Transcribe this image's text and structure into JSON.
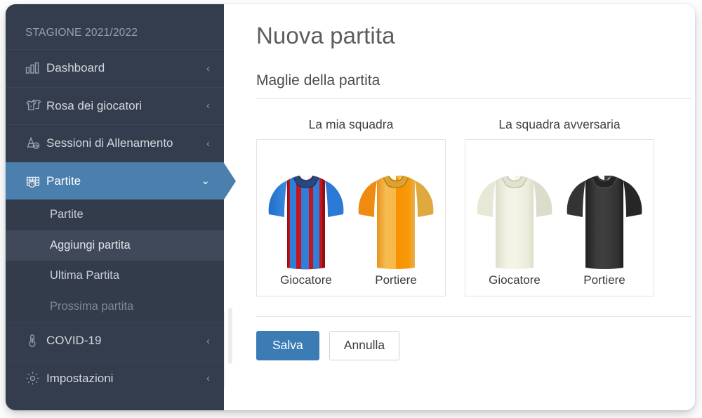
{
  "sidebar": {
    "season": "STAGIONE 2021/2022",
    "items": [
      {
        "label": "Dashboard",
        "icon": "bar-chart-icon",
        "caret": "‹",
        "active": false
      },
      {
        "label": "Rosa dei giocatori",
        "icon": "jerseys-icon",
        "caret": "‹",
        "active": false
      },
      {
        "label": "Sessioni di Allenamento",
        "icon": "training-cone-icon",
        "caret": "‹",
        "active": false
      },
      {
        "label": "Partite",
        "icon": "goal-ball-icon",
        "caret": "⌄",
        "active": true
      }
    ],
    "submenu": [
      {
        "label": "Partite",
        "state": "normal"
      },
      {
        "label": "Aggiungi partita",
        "state": "selected"
      },
      {
        "label": "Ultima Partita",
        "state": "normal"
      },
      {
        "label": "Prossima partita",
        "state": "disabled"
      }
    ],
    "bottom_items": [
      {
        "label": "COVID-19",
        "icon": "thermometer-icon",
        "caret": "‹"
      },
      {
        "label": "Impostazioni",
        "icon": "gear-icon",
        "caret": "‹"
      }
    ],
    "colors": {
      "background": "#343d4d",
      "submenu_background": "#333c4b",
      "active": "#4a7fae",
      "submenu_selected": "#3f4959",
      "text": "#d3d8df",
      "muted_text": "#98a0ad"
    }
  },
  "main": {
    "page_title": "Nuova partita",
    "section_title": "Maglie della partita",
    "kit_groups": [
      {
        "title": "La mia squadra",
        "kits": [
          {
            "caption": "Giocatore",
            "style": "striped-red-blue",
            "colors": {
              "stripe_a": "#c4161c",
              "stripe_b": "#2f7ed8",
              "sleeve": "#2f7ed8",
              "collar": "#29487f"
            }
          },
          {
            "caption": "Portiere",
            "style": "solid-amber",
            "colors": {
              "body_left": "#f5b942",
              "body_right": "#f59100",
              "sleeve": "#e8a22e",
              "collar": "#d99b2b"
            }
          }
        ]
      },
      {
        "title": "La squadra avversaria",
        "kits": [
          {
            "caption": "Giocatore",
            "style": "solid-cream",
            "colors": {
              "body_left": "#f2f2e3",
              "body_right": "#eaead8",
              "sleeve": "#e4e4d2",
              "collar": "#dedecc"
            }
          },
          {
            "caption": "Portiere",
            "style": "solid-black",
            "colors": {
              "body_left": "#3a3a3a",
              "body_right": "#2e2e2e",
              "sleeve": "#343434",
              "collar": "#262626"
            }
          }
        ]
      }
    ],
    "actions": {
      "save_label": "Salva",
      "cancel_label": "Annulla",
      "save_color": "#3b7cb5"
    }
  }
}
